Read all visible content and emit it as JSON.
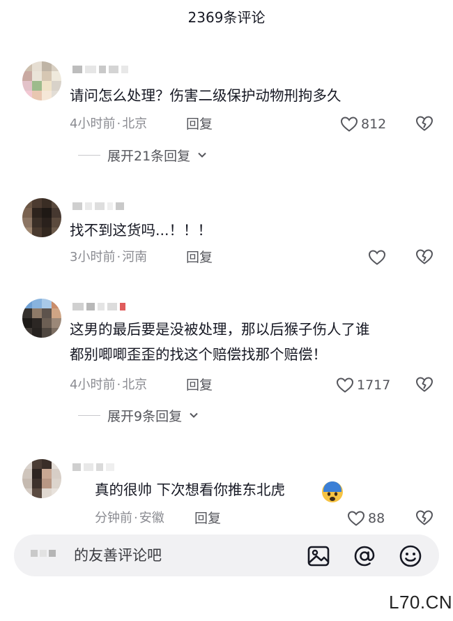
{
  "header": {
    "title": "2369条评论"
  },
  "comments": [
    {
      "text": "请问怎么处理？伤害二级保护动物刑拘多久",
      "time": "4小时前",
      "location": "北京",
      "reply_label": "回复",
      "likes": "812",
      "expand_label": "展开21条回复"
    },
    {
      "text": "找不到这货吗...！！！",
      "time": "3小时前",
      "location": "河南",
      "reply_label": "回复",
      "likes": "",
      "expand_label": ""
    },
    {
      "text": "这男的最后要是没被处理，那以后猴子伤人了谁\n都别唧唧歪歪的找这个赔偿找那个赔偿！",
      "time": "4小时前",
      "location": "北京",
      "reply_label": "回复",
      "likes": "1717",
      "expand_label": "展开9条回复"
    },
    {
      "text": "真的很帅 下次想看你推东北虎",
      "time": "分钟前",
      "location": "安徽",
      "reply_label": "回复",
      "likes": "88",
      "expand_label": ""
    }
  ],
  "meta_separator": "·",
  "comment_bar": {
    "placeholder": "的友善评论吧",
    "icons": [
      "image-icon",
      "at-icon",
      "emoji-icon"
    ]
  },
  "watermark": "L70.CN",
  "colors": {
    "text": "#161823",
    "meta": "#8a8b91",
    "secondary": "#55565c"
  }
}
